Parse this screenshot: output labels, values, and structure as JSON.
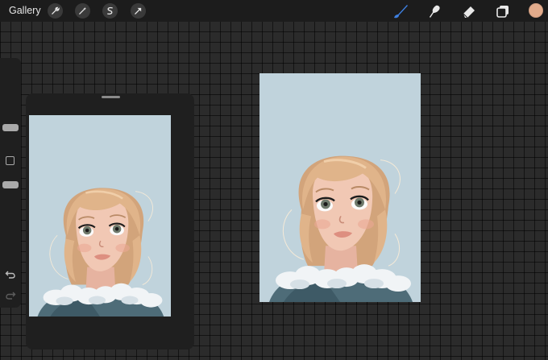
{
  "topbar": {
    "gallery_label": "Gallery",
    "left_tools": [
      "wrench-icon",
      "magic-wand-icon",
      "selection-icon",
      "transform-arrow-icon"
    ],
    "right_tools": [
      "brush-icon",
      "smudge-icon",
      "eraser-icon",
      "layers-icon"
    ],
    "active_tool": "brush-icon",
    "current_color": "#e3ac8c"
  },
  "sidebar": {
    "items": [
      "brush-size-slider",
      "modify-button",
      "opacity-slider",
      "undo-icon",
      "redo-icon"
    ]
  },
  "reference_window": {
    "content": "reference-image-portrait"
  },
  "canvas": {
    "background_color": "#c0d3dc",
    "content": "girl-portrait-illustration"
  },
  "colors": {
    "background": "#2b2b2b",
    "toolbar": "#1c1c1c",
    "accent_blue": "#3d7fe0",
    "canvas_blue": "#c0d3dc",
    "hair": "#e0b48a",
    "skin": "#f1c8b4",
    "sweater": "#4e6c78"
  }
}
